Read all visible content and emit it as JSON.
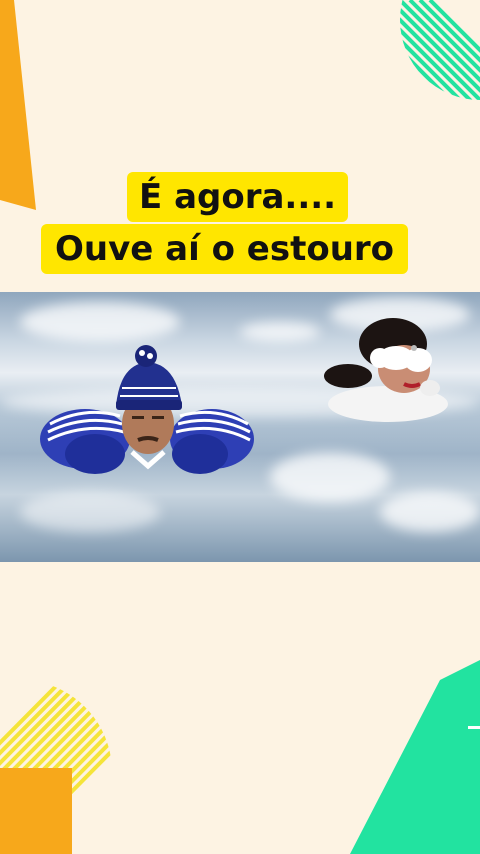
{
  "caption": {
    "line1": "É agora....",
    "line2": "Ouve aí o estouro"
  },
  "colors": {
    "background": "#fdf3e3",
    "caption_bg": "#ffe600",
    "accent_orange": "#f7a81b",
    "accent_green": "#22e3a0",
    "accent_yellow_stripes": "#f5e43a"
  },
  "scene": {
    "left_character": "flying-man-blue-beanie",
    "right_character": "flying-woman-white-mask",
    "setting": "sky-clouds"
  }
}
